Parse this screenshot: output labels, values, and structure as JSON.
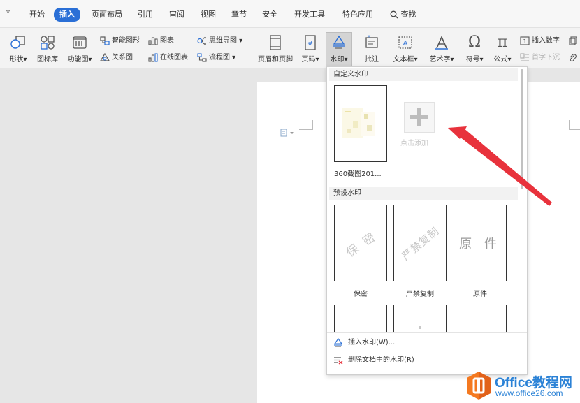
{
  "menu": {
    "qa_arrow": "▿",
    "items": [
      "开始",
      "插入",
      "页面布局",
      "引用",
      "审阅",
      "视图",
      "章节",
      "安全",
      "开发工具",
      "特色应用",
      "查找"
    ]
  },
  "ribbon": {
    "shape": "形状",
    "icon_lib": "图标库",
    "function_chart": "功能图",
    "smart_art": "智能图形",
    "chart": "图表",
    "mind_map": "思维导图",
    "relation": "关系图",
    "online_chart": "在线图表",
    "flowchart": "流程图",
    "header_footer": "页眉和页脚",
    "page_num": "页码",
    "watermark": "水印",
    "comment": "批注",
    "textbox": "文本框",
    "wordart": "艺术字",
    "symbol": "符号",
    "formula": "公式",
    "insert_number": "插入数字",
    "drop_cap": "首字下沉"
  },
  "dropdown": {
    "custom_section": "自定义水印",
    "custom_caption": "360截图201...",
    "add_label": "点击添加",
    "preset_section": "预设水印",
    "presets": [
      {
        "label": "保密",
        "mark": "保 密"
      },
      {
        "label": "严禁复制",
        "mark": "严禁复制"
      },
      {
        "label": "原件",
        "mark": "原 件"
      }
    ],
    "insert_action": "插入水印(W)...",
    "delete_action": "删除文档中的水印(R)"
  },
  "logo": {
    "name": "Office教程网",
    "url": "www.office26.com"
  },
  "colors": {
    "accent": "#2a6fd6",
    "arrow": "#e8323c",
    "logo_orange": "#f47920",
    "logo_blue": "#2b82d6"
  }
}
